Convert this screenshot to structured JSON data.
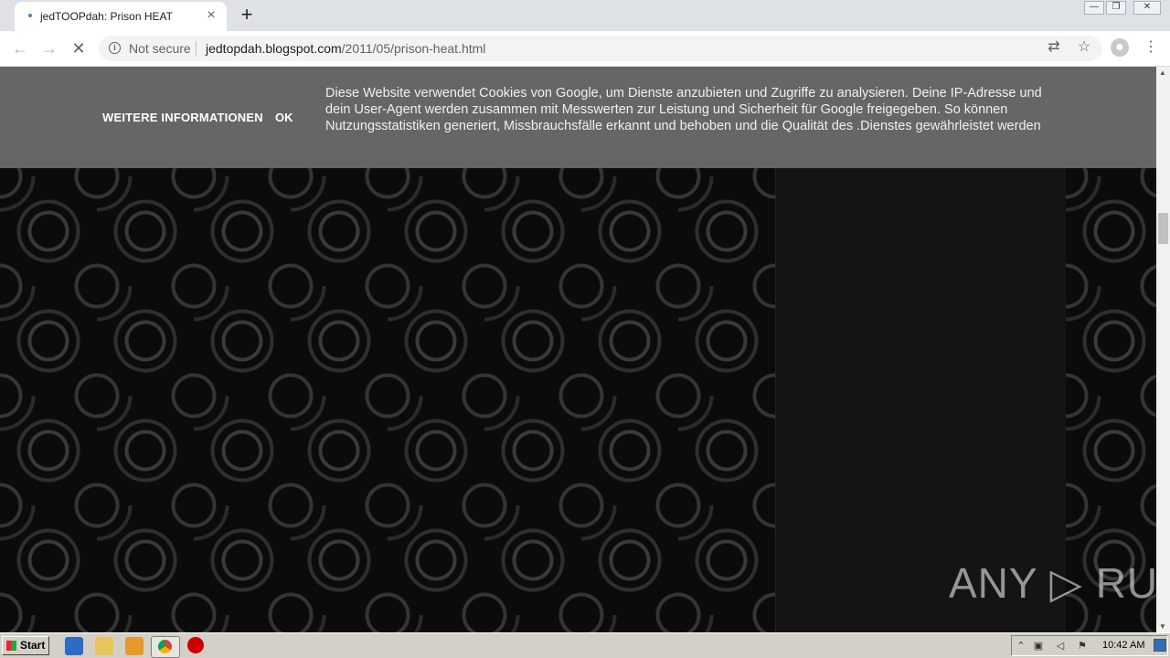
{
  "browser": {
    "tab_title": "jedTOOPdah: Prison HEAT",
    "tab_close": "×",
    "new_tab": "+",
    "security_label": "Not secure",
    "url_domain": "jedtopdah.blogspot.com",
    "url_path": "/2011/05/prison-heat.html"
  },
  "cookie_bar": {
    "more_info": "WEITERE INFORMATIONEN",
    "ok": "OK",
    "message": "Diese Website verwendet Cookies von Google, um Dienste anzubieten und Zugriffe zu analysieren. Deine IP-Adresse und dein User-Agent werden zusammen mit Messwerten zur Leistung und Sicherheit für Google freigegeben. So können Nutzungsstatistiken generiert, Missbrauchsfälle erkannt und behoben und die Qualität des .Dienstes gewährleistet werden"
  },
  "watermark": "ANY ▷ RUN",
  "taskbar": {
    "start_label": "Start",
    "clock": "10:42 AM"
  }
}
